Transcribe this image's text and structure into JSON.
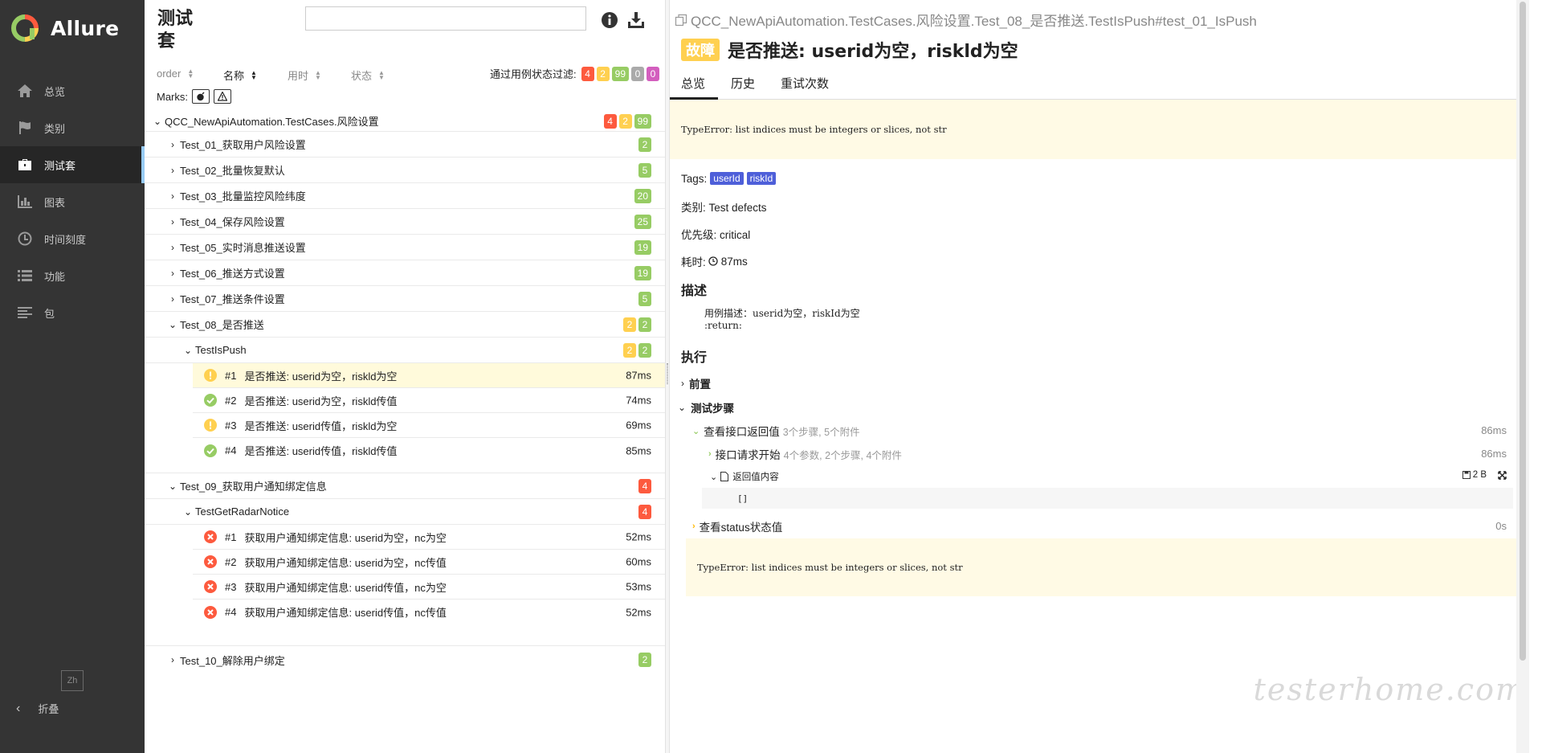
{
  "app": {
    "name": "Allure",
    "colors": {
      "sidebar_bg": "#343434",
      "sidebar_active_bg": "#262626",
      "accent": "#97cbf4",
      "failed": "#fd5a3e",
      "broken": "#ffd050",
      "passed": "#97cc64",
      "skipped": "#aaaaaa",
      "unknown": "#d35ebe"
    }
  },
  "sidebar": {
    "items": [
      {
        "label": "总览",
        "icon": "home-icon"
      },
      {
        "label": "类别",
        "icon": "flag-icon"
      },
      {
        "label": "测试套",
        "icon": "briefcase-icon",
        "active": true
      },
      {
        "label": "图表",
        "icon": "bar-chart-icon"
      },
      {
        "label": "时间刻度",
        "icon": "clock-icon"
      },
      {
        "label": "功能",
        "icon": "list-icon"
      },
      {
        "label": "包",
        "icon": "align-left-icon"
      }
    ],
    "lang": "Zh",
    "collapse_label": "折叠"
  },
  "tree_pane": {
    "title": "测试套",
    "search": {
      "value": "",
      "placeholder": ""
    },
    "sort": {
      "order": "order",
      "name": "名称",
      "duration": "用时",
      "status": "状态"
    },
    "filter_label": "通过用例状态过滤:",
    "filter_counts": {
      "failed": "4",
      "broken": "2",
      "passed": "99",
      "skipped": "0",
      "unknown": "0"
    },
    "marks_label": "Marks:",
    "root": {
      "name": "QCC_NewApiAutomation.TestCases.风险设置",
      "counts": [
        "4",
        "2",
        "99"
      ]
    },
    "suites": [
      {
        "name": "Test_01_获取用户风险设置",
        "passed": "2"
      },
      {
        "name": "Test_02_批量恢复默认",
        "passed": "5"
      },
      {
        "name": "Test_03_批量监控风险纬度",
        "passed": "20"
      },
      {
        "name": "Test_04_保存风险设置",
        "passed": "25"
      },
      {
        "name": "Test_05_实时消息推送设置",
        "passed": "19"
      },
      {
        "name": "Test_06_推送方式设置",
        "passed": "19"
      },
      {
        "name": "Test_07_推送条件设置",
        "passed": "5"
      }
    ],
    "suite08": {
      "name": "Test_08_是否推送",
      "broken": "2",
      "passed": "2",
      "cls": {
        "name": "TestIsPush",
        "broken": "2",
        "passed": "2"
      },
      "cases": [
        {
          "num": "#1",
          "name": "是否推送: userid为空，riskld为空",
          "dur": "87ms",
          "status": "broken"
        },
        {
          "num": "#2",
          "name": "是否推送: userid为空，riskld传值",
          "dur": "74ms",
          "status": "passed"
        },
        {
          "num": "#3",
          "name": "是否推送: userid传值，riskld为空",
          "dur": "69ms",
          "status": "broken"
        },
        {
          "num": "#4",
          "name": "是否推送: userid传值，riskld传值",
          "dur": "85ms",
          "status": "passed"
        }
      ]
    },
    "suite09": {
      "name": "Test_09_获取用户通知绑定信息",
      "failed": "4",
      "cls": {
        "name": "TestGetRadarNotice",
        "failed": "4"
      },
      "cases": [
        {
          "num": "#1",
          "name": "获取用户通知绑定信息: userid为空，nc为空",
          "dur": "52ms",
          "status": "failed"
        },
        {
          "num": "#2",
          "name": "获取用户通知绑定信息: userid为空，nc传值",
          "dur": "60ms",
          "status": "failed"
        },
        {
          "num": "#3",
          "name": "获取用户通知绑定信息: userid传值，nc为空",
          "dur": "53ms",
          "status": "failed"
        },
        {
          "num": "#4",
          "name": "获取用户通知绑定信息: userid传值，nc传值",
          "dur": "52ms",
          "status": "failed"
        }
      ]
    },
    "suite10": {
      "name": "Test_10_解除用户绑定",
      "passed": "2"
    }
  },
  "detail": {
    "fullname": "QCC_NewApiAutomation.TestCases.风险设置.Test_08_是否推送.TestIsPush#test_01_IsPush",
    "status_label": "故障",
    "title": "是否推送: userid为空，riskld为空",
    "tabs": [
      "总览",
      "历史",
      "重试次数"
    ],
    "error": "TypeError: list indices must be integers or slices, not str",
    "tags_label": "Tags:",
    "tags": [
      "userId",
      "riskId"
    ],
    "category": "类别: Test defects",
    "severity": "优先级: critical",
    "duration_label": "耗时:",
    "duration": "87ms",
    "description_title": "描述",
    "description": "用例描述：userid为空，riskId为空\n:return:",
    "execution_title": "执行",
    "setup_label": "前置",
    "steps_label": "测试步骤",
    "step1": {
      "name": "查看接口返回值",
      "meta": "3个步骤, 5个附件",
      "dur": "86ms"
    },
    "step1a": {
      "name": "接口请求开始",
      "meta": "4个参数, 2个步骤, 4个附件",
      "dur": "86ms"
    },
    "attachment": {
      "name": "返回值内容",
      "size": "2 B",
      "content": "[]"
    },
    "step2": {
      "name": "查看status状态值",
      "dur": "0s"
    },
    "error2": "TypeError: list indices must be integers or slices, not str"
  },
  "watermark": "testerhome.com"
}
